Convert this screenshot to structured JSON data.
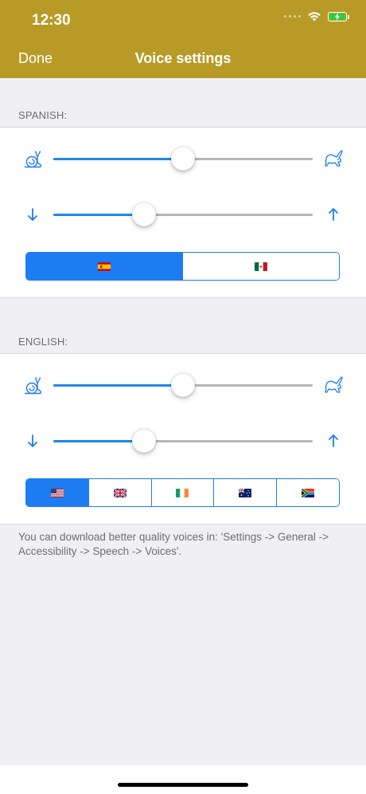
{
  "status_bar": {
    "time": "12:30"
  },
  "nav": {
    "done_label": "Done",
    "title": "Voice settings"
  },
  "sections": [
    {
      "header": "SPANISH:",
      "speed": {
        "slow_icon": "snail-icon",
        "fast_icon": "rabbit-icon",
        "value": 0.5
      },
      "pitch": {
        "low_icon": "arrow-down-icon",
        "high_icon": "arrow-up-icon",
        "value": 0.35
      },
      "languages": [
        {
          "flag": "spain-flag-icon",
          "selected": true
        },
        {
          "flag": "mexico-flag-icon",
          "selected": false
        }
      ]
    },
    {
      "header": "ENGLISH:",
      "speed": {
        "slow_icon": "snail-icon",
        "fast_icon": "rabbit-icon",
        "value": 0.5
      },
      "pitch": {
        "low_icon": "arrow-down-icon",
        "high_icon": "arrow-up-icon",
        "value": 0.35
      },
      "languages": [
        {
          "flag": "usa-flag-icon",
          "selected": true
        },
        {
          "flag": "uk-flag-icon",
          "selected": false
        },
        {
          "flag": "ireland-flag-icon",
          "selected": false
        },
        {
          "flag": "australia-flag-icon",
          "selected": false
        },
        {
          "flag": "south-africa-flag-icon",
          "selected": false
        }
      ]
    }
  ],
  "footer_note": "You can download better quality voices in: 'Settings -> General -> Accessibility -> Speech -> Voices'.",
  "colors": {
    "header": "#b89b27",
    "accent": "#1e7cf2",
    "slider_fill": "#1e88e5"
  }
}
